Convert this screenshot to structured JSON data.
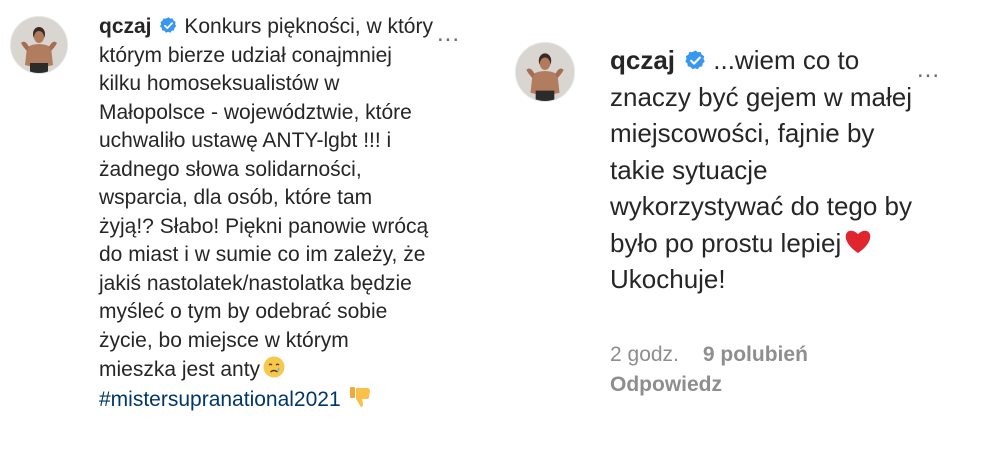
{
  "left_post": {
    "username": "qczaj",
    "verified_icon": "verified-badge-icon",
    "more_icon": "more-options-icon",
    "more_label": "...",
    "lines": [
      "Konkurs piękności, w którym",
      "którym bierze udział conajmniej",
      "kilku homoseksualistów w",
      "Małopolsce - województwie, które",
      "uchwaliło ustawę ANTY-lgbt !!! i",
      "żadnego słowa solidarności,",
      "wsparcia, dla osób, które tam",
      "żyją!? Słabo! Piękni panowie wrócą",
      "do miast i w sumie co im zależy, że",
      "jakiś nastolatek/nastolatka będzie",
      "myśleć o tym by odebrać sobie",
      "życie, bo miejsce w którym",
      "mieszka jest anty"
    ],
    "crying_emoji": "crying-face-emoji",
    "hashtag": "#mistersupranational2021",
    "thumbs_down_emoji": "thumbs-down-emoji"
  },
  "right_comment": {
    "username": "qczaj",
    "verified_icon": "verified-badge-icon",
    "more_icon": "more-options-icon",
    "more_label": "...",
    "lines": [
      "...wiem co to",
      "znaczy być gejem w małej",
      "miejscowości, fajnie by",
      "takie sytuacje",
      "wykorzystywać do tego by",
      "było po prostu lepiej"
    ],
    "heart_emoji": "red-heart-emoji",
    "last_line": "Ukochuje!",
    "time": "2 godz.",
    "likes": "9 polubień",
    "reply": "Odpowiedz"
  },
  "colors": {
    "text": "#262626",
    "meta": "#8e8e8e",
    "hashtag": "#00376b",
    "verified": "#3897f0",
    "heart": "#e0252f"
  }
}
